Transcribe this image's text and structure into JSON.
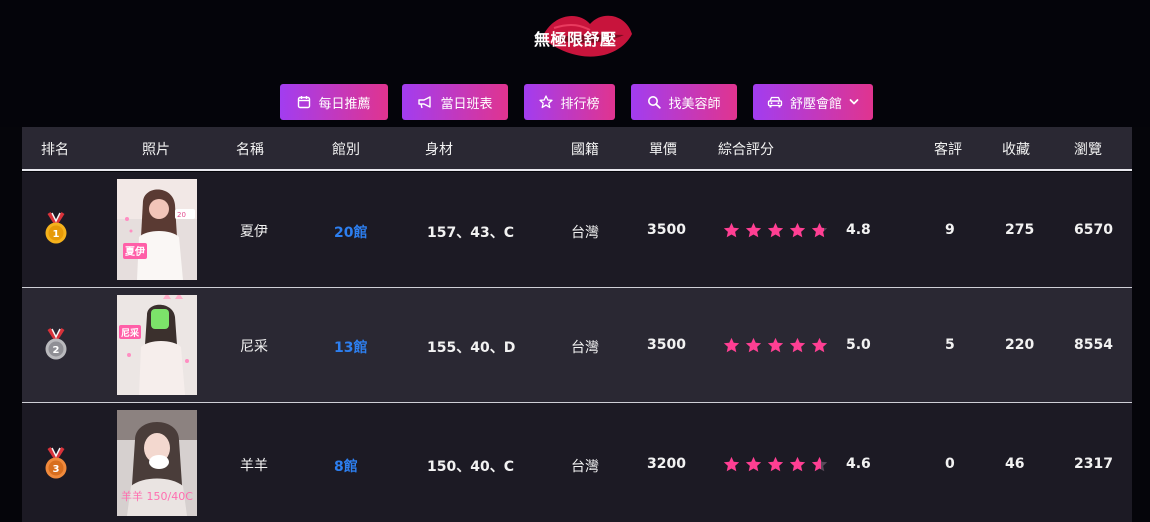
{
  "site": {
    "title": "無極限舒壓",
    "accent_gradient": [
      "#a23df0",
      "#e0348f"
    ],
    "star_color": "#ff3f93",
    "link_color": "#2d7ff0"
  },
  "nav": [
    {
      "label": "每日推薦",
      "icon": "calendar-icon"
    },
    {
      "label": "當日班表",
      "icon": "megaphone-icon"
    },
    {
      "label": "排行榜",
      "icon": "star-icon"
    },
    {
      "label": "找美容師",
      "icon": "search-icon"
    },
    {
      "label": "舒壓會館",
      "icon": "car-icon",
      "dropdown": true
    }
  ],
  "table": {
    "headers": [
      "排名",
      "照片",
      "名稱",
      "館別",
      "身材",
      "國籍",
      "單價",
      "綜合評分",
      "客評",
      "收藏",
      "瀏覽"
    ],
    "rows": [
      {
        "rank": 1,
        "medal": "gold-medal-icon",
        "name": "夏伊",
        "branch": "20館",
        "body": "157、43、C",
        "nationality": "台灣",
        "price": "3500",
        "rating": 4.8,
        "rating_text": "4.8",
        "reviews": "9",
        "favorites": "275",
        "views": "6570"
      },
      {
        "rank": 2,
        "medal": "silver-medal-icon",
        "name": "尼采",
        "branch": "13館",
        "body": "155、40、D",
        "nationality": "台灣",
        "price": "3500",
        "rating": 5.0,
        "rating_text": "5.0",
        "reviews": "5",
        "favorites": "220",
        "views": "8554"
      },
      {
        "rank": 3,
        "medal": "bronze-medal-icon",
        "name": "羊羊",
        "branch": "8館",
        "body": "150、40、C",
        "nationality": "台灣",
        "price": "3200",
        "rating": 4.6,
        "rating_text": "4.6",
        "reviews": "0",
        "favorites": "46",
        "views": "2317"
      }
    ]
  }
}
